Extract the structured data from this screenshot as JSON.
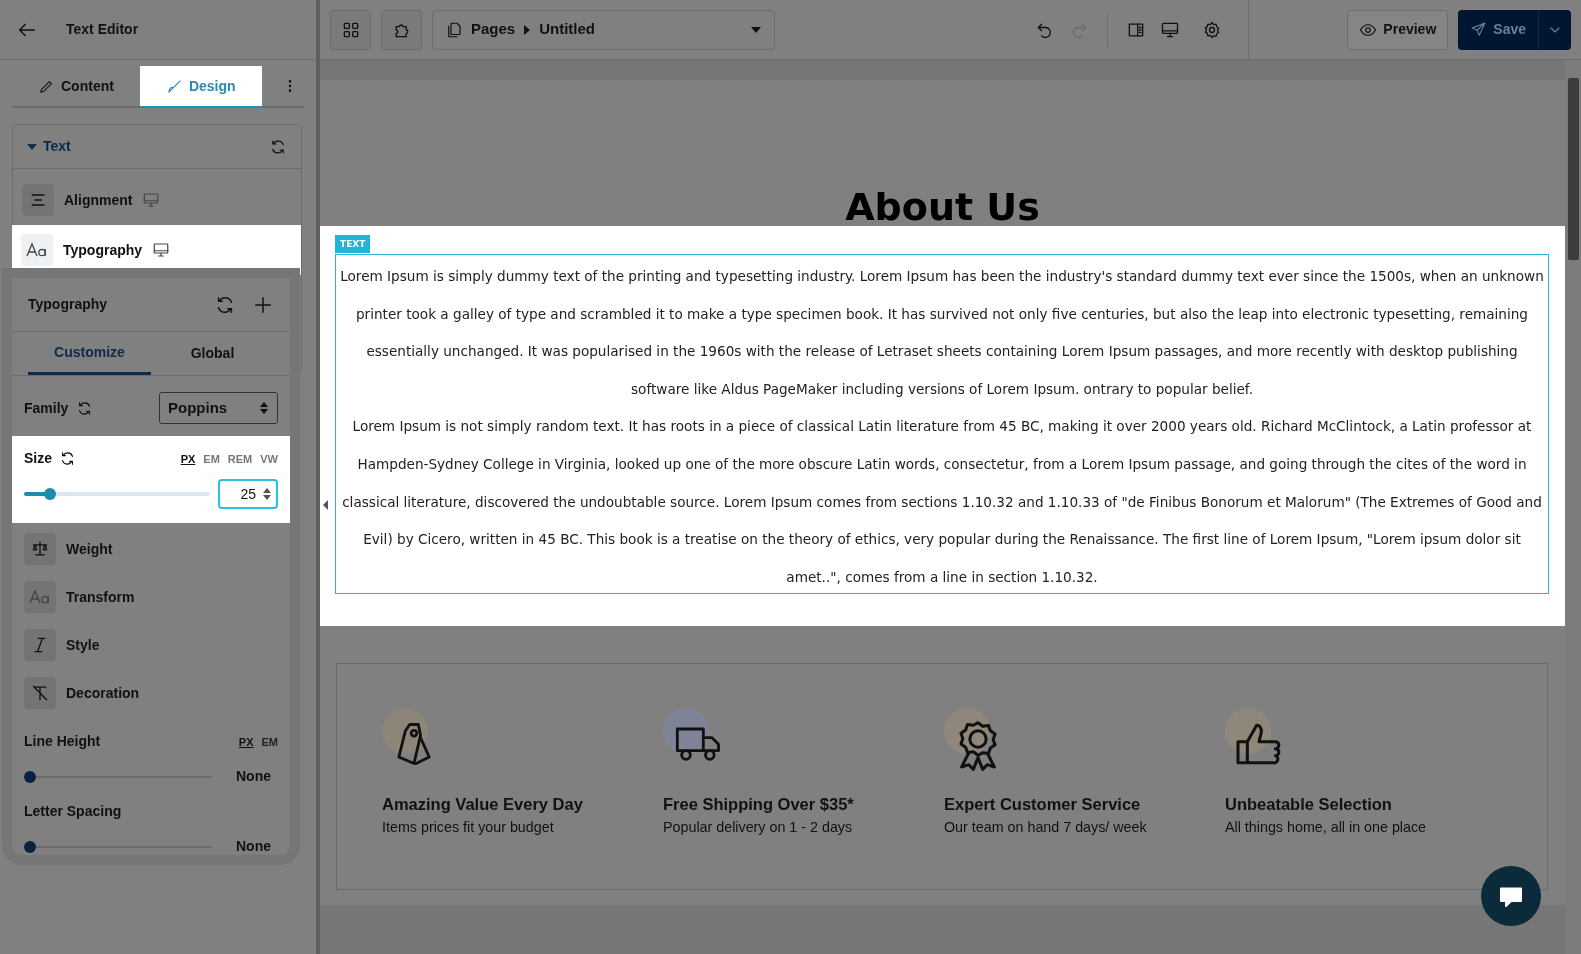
{
  "sidebar": {
    "title": "Text Editor",
    "tabs": [
      {
        "label": "Content",
        "kind": "pencil",
        "selected": false
      },
      {
        "label": "Design",
        "kind": "brush",
        "selected": true
      }
    ],
    "section": {
      "title": "Text",
      "expanded": true,
      "items": [
        {
          "label": "Alignment",
          "kind": "align",
          "selected": false
        },
        {
          "label": "Typography",
          "kind": "aa",
          "selected": true
        }
      ]
    }
  },
  "typography_panel": {
    "title": "Typography",
    "tabs": [
      {
        "label": "Customize",
        "selected": true
      },
      {
        "label": "Global",
        "selected": false
      }
    ],
    "family": {
      "label": "Family",
      "value": "Poppins"
    },
    "size": {
      "label": "Size",
      "units": [
        {
          "label": "PX",
          "selected": true
        },
        {
          "label": "EM",
          "selected": false
        },
        {
          "label": "REM",
          "selected": false
        },
        {
          "label": "VW",
          "selected": false
        }
      ],
      "level": 0.14,
      "value": "25"
    },
    "options": [
      {
        "label": "Weight",
        "kind": "weight"
      },
      {
        "label": "Transform",
        "kind": "transform"
      },
      {
        "label": "Style",
        "kind": "style"
      },
      {
        "label": "Decoration",
        "kind": "decoration"
      }
    ],
    "line_height": {
      "label": "Line Height",
      "units": [
        {
          "label": "PX",
          "selected": true
        },
        {
          "label": "EM",
          "selected": false
        }
      ],
      "level": 0,
      "reading": "None"
    },
    "letter_spacing": {
      "label": "Letter Spacing",
      "level": 0,
      "reading": "None"
    }
  },
  "toolbar": {
    "breadcrumb": [
      "Pages",
      "Untitled"
    ],
    "undo_disabled": false,
    "redo_disabled": true,
    "preview": "Preview",
    "save": "Save"
  },
  "canvas": {
    "heading": "About Us",
    "badge": "TEXT",
    "paragraphs": [
      "Lorem Ipsum is simply dummy text of the printing and typesetting industry. Lorem Ipsum has been the industry's standard dummy text ever since the 1500s, when an unknown printer took a galley of type and scrambled it to make a type specimen book. It has survived not only five centuries, but also the leap into electronic typesetting, remaining essentially unchanged. It was popularised in the 1960s with the release of Letraset sheets containing Lorem Ipsum passages, and more recently with desktop publishing software like Aldus PageMaker including versions of Lorem Ipsum. ontrary to popular belief.",
      "Lorem Ipsum is not simply random text. It has roots in a piece of classical Latin literature from 45 BC, making it over 2000 years old. Richard McClintock, a Latin professor at Hampden-Sydney College in Virginia, looked up one of the more obscure Latin words, consectetur, from a Lorem Ipsum passage, and going through the cites of the word in classical literature, discovered the undoubtable source. Lorem Ipsum comes from sections 1.10.32 and 1.10.33 of \"de Finibus Bonorum et Malorum\" (The Extremes of Good and Evil) by Cicero, written in 45 BC. This book is a treatise on the theory of ethics, very popular during the Renaissance. The first line of Lorem Ipsum, \"Lorem ipsum dolor sit amet..\", comes from a line in section 1.10.32."
    ],
    "features": [
      {
        "kind": "tag",
        "color": "#8e8579",
        "title": "Amazing Value Every Day",
        "subtitle": "Items prices fit your budget"
      },
      {
        "kind": "truck",
        "color": "#7e8398",
        "title": "Free Shipping Over $35*",
        "subtitle": "Popular delivery on 1 - 2 days"
      },
      {
        "kind": "award",
        "color": "#8f877a",
        "title": "Expert Customer Service",
        "subtitle": "Our team on hand 7 days/ week"
      },
      {
        "kind": "thumb",
        "color": "#8f877a",
        "title": "Unbeatable Selection",
        "subtitle": "All things home, all in one place"
      }
    ]
  }
}
